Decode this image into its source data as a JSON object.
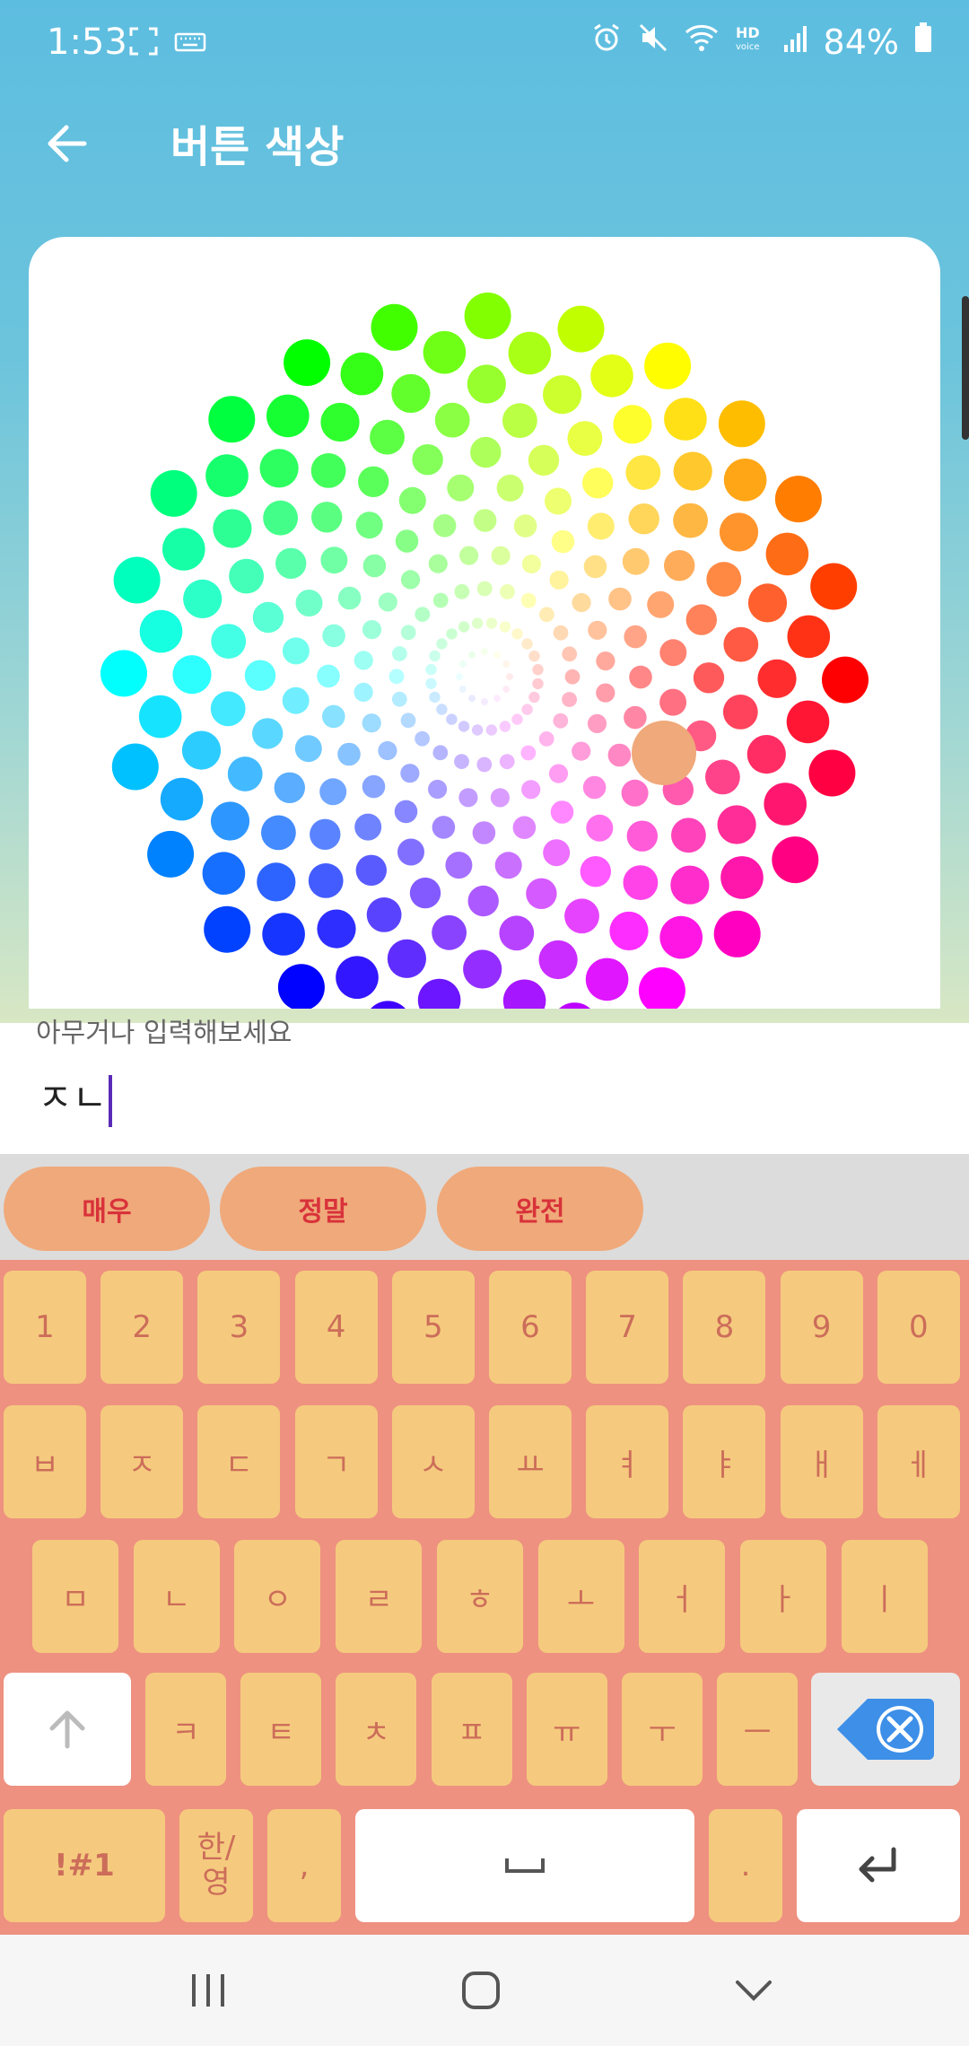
{
  "status_bar": {
    "time": "1:53",
    "battery": "84%",
    "icons": [
      "screenshot-frame-icon",
      "keyboard-icon",
      "alarm-icon",
      "mute-icon",
      "wifi-icon",
      "hd-voice-icon",
      "signal-icon",
      "battery-icon"
    ]
  },
  "app_bar": {
    "title": "버튼 색상",
    "back_icon": "arrow-left-icon"
  },
  "color_picker": {
    "selected_color": "#f0a97a",
    "palette": "hsv-dot-wheel"
  },
  "input": {
    "label": "아무거나 입력해보세요",
    "value": "ㅈㄴ"
  },
  "suggestions": [
    "매우",
    "정말",
    "완전"
  ],
  "colors": {
    "accent": "#f0a97a",
    "keyboard_bg": "#ee9180",
    "key_bg": "#f5ca7e",
    "key_text": "#cc6d5a",
    "suggest_text": "#d8323a"
  },
  "keyboard": {
    "row_numbers": [
      "1",
      "2",
      "3",
      "4",
      "5",
      "6",
      "7",
      "8",
      "9",
      "0"
    ],
    "row1": [
      "ㅂ",
      "ㅈ",
      "ㄷ",
      "ㄱ",
      "ㅅ",
      "ㅛ",
      "ㅕ",
      "ㅑ",
      "ㅐ",
      "ㅔ"
    ],
    "row2": [
      "ㅁ",
      "ㄴ",
      "ㅇ",
      "ㄹ",
      "ㅎ",
      "ㅗ",
      "ㅓ",
      "ㅏ",
      "ㅣ"
    ],
    "row3": [
      "ㅋ",
      "ㅌ",
      "ㅊ",
      "ㅍ",
      "ㅠ",
      "ㅜ",
      "ㅡ"
    ],
    "symbols": "!#1",
    "lang": "한/영",
    "comma": ",",
    "space": "␣",
    "period": ".",
    "shift_icon": "shift-arrow-icon",
    "backspace_icon": "backspace-icon",
    "enter_icon": "enter-icon"
  },
  "nav_bar": {
    "icons": [
      "recent-apps-icon",
      "home-icon",
      "back-chevron-icon"
    ]
  }
}
